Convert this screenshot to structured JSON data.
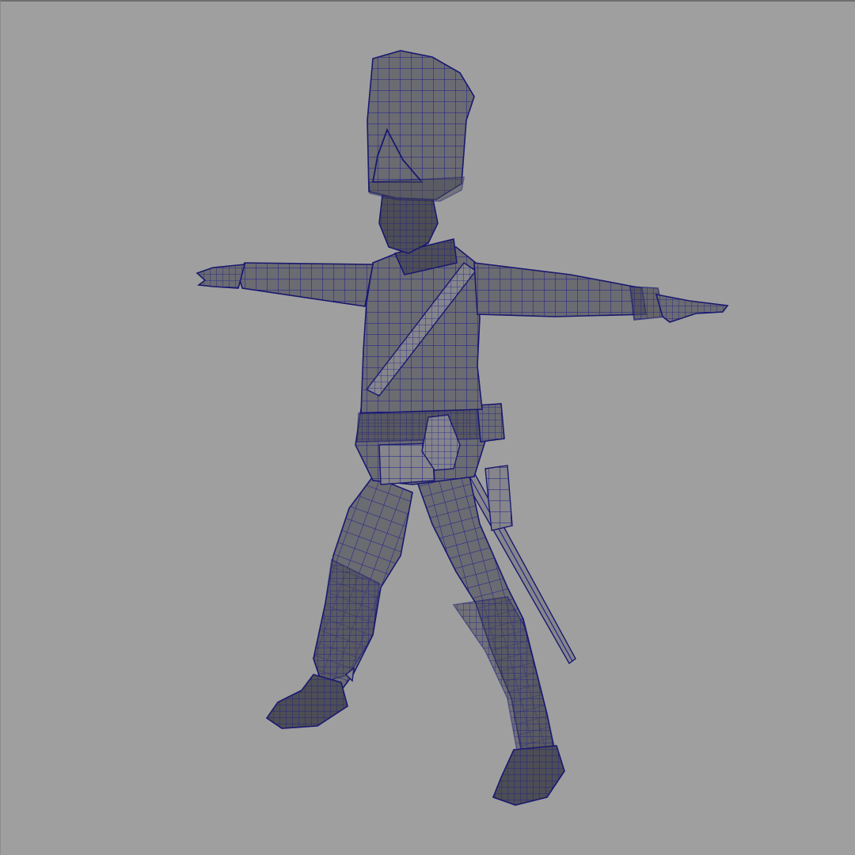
{
  "viewport": {
    "background_color": "#9f9f9f",
    "wireframe_color": "#1c1c8c",
    "mesh_shade_color": "#6b6b72"
  },
  "model": {
    "subject": "soldier-character-mesh",
    "pose": "t-pose",
    "display_mode": "wireframe-on-shaded"
  }
}
